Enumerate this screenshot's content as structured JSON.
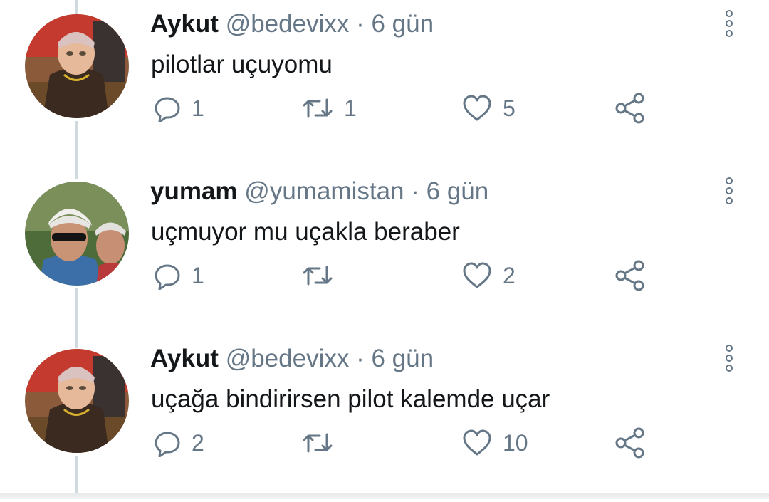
{
  "tweets": [
    {
      "name": "Aykut",
      "handle": "@bedevixx",
      "separator": "·",
      "time": "6 gün",
      "text": "pilotlar uçuyomu",
      "replies": "1",
      "retweets": "1",
      "likes": "5",
      "avatar": "avatar-aykut"
    },
    {
      "name": "yumam",
      "handle": "@yumamistan",
      "separator": "·",
      "time": "6 gün",
      "text": "uçmuyor mu uçakla beraber",
      "replies": "1",
      "retweets": "",
      "likes": "2",
      "avatar": "avatar-yumam"
    },
    {
      "name": "Aykut",
      "handle": "@bedevixx",
      "separator": "·",
      "time": "6 gün",
      "text": "uçağa bindirirsen pilot kalemde uçar",
      "replies": "2",
      "retweets": "",
      "likes": "10",
      "avatar": "avatar-aykut"
    }
  ],
  "icons": {
    "reply": "reply-icon",
    "retweet": "retweet-icon",
    "like": "heart-icon",
    "share": "share-icon",
    "more": "more-options-icon"
  },
  "colors": {
    "text": "#14171a",
    "secondary": "#657786",
    "thread_line": "#cfd9de"
  }
}
